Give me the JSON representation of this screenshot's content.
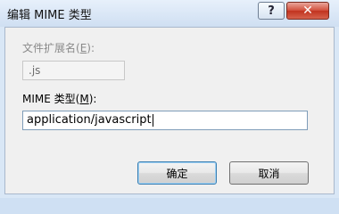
{
  "window": {
    "title": "编辑 MIME 类型",
    "help_glyph": "?",
    "close_glyph": "✕"
  },
  "extension": {
    "label": "文件扩展名(",
    "accesskey": "E",
    "label_suffix": "):",
    "value": ".js"
  },
  "mime": {
    "label": "MIME 类型(",
    "accesskey": "M",
    "label_suffix": "):",
    "value": "application/javascript"
  },
  "buttons": {
    "ok_label": "确定",
    "cancel_label": "取消"
  }
}
